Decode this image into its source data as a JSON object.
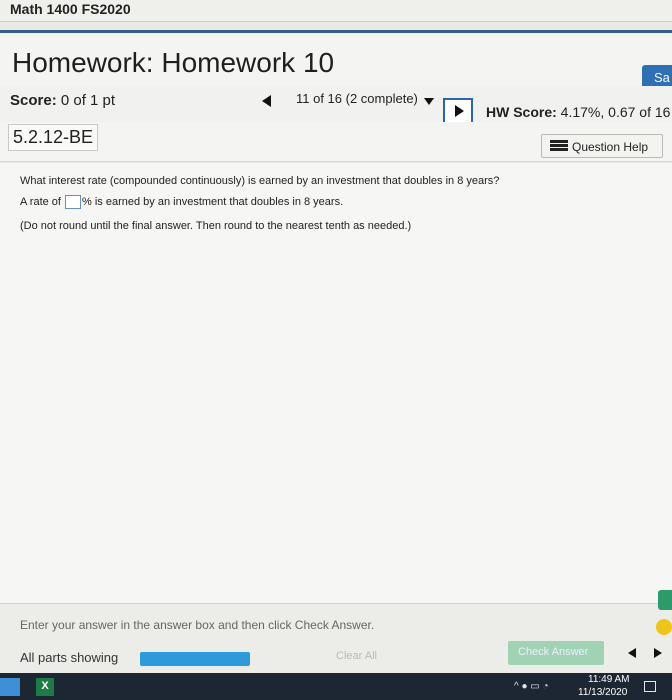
{
  "browser": {
    "course_title": "Math 1400 FS2020"
  },
  "header": {
    "title": "Homework: Homework 10",
    "save_label": "Sa"
  },
  "score_bar": {
    "score_label": "Score:",
    "score_value": " 0 of 1 pt",
    "progress": "11 of 16 (2 complete)",
    "hw_score_label": "HW Score:",
    "hw_score_value": " 4.17%, 0.67 of 16"
  },
  "problem": {
    "id": "5.2.12-BE",
    "help_label": "Question Help",
    "question": "What interest rate (compounded continuously) is earned by an investment that doubles in 8 years?",
    "answer_prefix": "A rate of ",
    "answer_suffix": "% is earned by an investment that doubles in 8 years.",
    "answer_value": "",
    "instruction": "(Do not round until the final answer. Then round to the nearest tenth as needed.)"
  },
  "footer": {
    "note": "Enter your answer in the answer box and then click Check Answer.",
    "parts_label": "All parts showing",
    "clear_label": "Clear All",
    "check_label": "Check Answer"
  },
  "taskbar": {
    "excel_label": "X",
    "tray_icons": "^ ● ▭ ◔",
    "time": "11:49 AM",
    "date": "11/13/2020"
  },
  "colors": {
    "accent_blue": "#2f6fb3",
    "parts_bar": "#2d9ad9",
    "check_button": "#9fd3b4"
  }
}
